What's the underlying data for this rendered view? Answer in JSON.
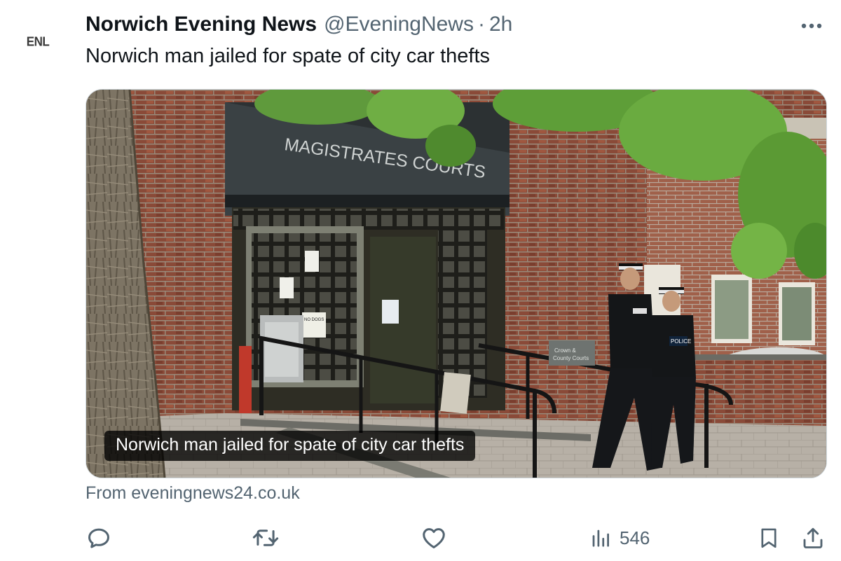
{
  "post": {
    "avatar_text": "ENL",
    "author_name": "Norwich Evening News",
    "handle": "@EveningNews",
    "separator": "·",
    "time": "2h",
    "text": "Norwich man jailed for spate of city car thefts"
  },
  "card": {
    "caption": "Norwich man jailed for spate of city car thefts",
    "source": "From eveningnews24.co.uk",
    "image_signage": {
      "building_sign": "MAGISTRATES COURTS",
      "door_notice": "NO DOGS ALLOWED",
      "wall_plaque": "Crown & County Courts",
      "vest_label": "POLICE"
    }
  },
  "actions": {
    "views": "546",
    "icons": [
      "reply-icon",
      "retweet-icon",
      "like-icon",
      "views-icon",
      "bookmark-icon",
      "share-icon"
    ]
  },
  "colors": {
    "text_primary": "#0f1419",
    "text_secondary": "#536471",
    "border": "#cfd9de"
  }
}
